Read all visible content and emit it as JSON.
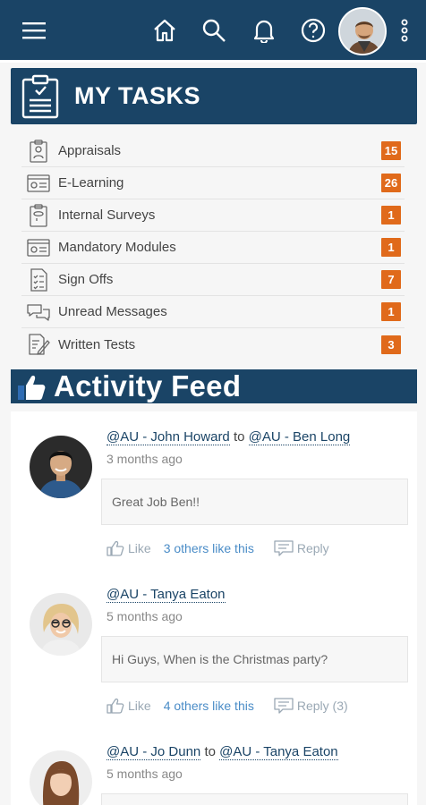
{
  "nav": {
    "menu_icon": "hamburger-menu-icon",
    "icons": [
      "home-icon",
      "search-icon",
      "bell-icon",
      "help-icon"
    ],
    "more_icon": "vertical-dots-icon"
  },
  "tasks": {
    "title": "MY TASKS",
    "items": [
      {
        "label": "Appraisals",
        "count": "15",
        "icon": "appraisal-icon"
      },
      {
        "label": "E-Learning",
        "count": "26",
        "icon": "elearning-icon"
      },
      {
        "label": "Internal Surveys",
        "count": "1",
        "icon": "survey-icon"
      },
      {
        "label": "Mandatory Modules",
        "count": "1",
        "icon": "module-icon"
      },
      {
        "label": "Sign Offs",
        "count": "7",
        "icon": "checklist-icon"
      },
      {
        "label": "Unread Messages",
        "count": "1",
        "icon": "chat-icon"
      },
      {
        "label": "Written Tests",
        "count": "3",
        "icon": "pencil-doc-icon"
      }
    ]
  },
  "feed": {
    "title": "Activity Feed",
    "posts": [
      {
        "author": "@AU - John Howard",
        "connector": "to",
        "target": "@AU - Ben Long",
        "time": "3 months ago",
        "message": "Great Job Ben!!",
        "like_label": "Like",
        "likes_text": "3 others like this",
        "reply_label": "Reply"
      },
      {
        "author": "@AU - Tanya Eaton",
        "connector": "",
        "target": "",
        "time": "5 months ago",
        "message": "Hi Guys, When is the Christmas party?",
        "like_label": "Like",
        "likes_text": "4 others like this",
        "reply_label": "Reply (3)"
      },
      {
        "author": "@AU - Jo Dunn",
        "connector": "to",
        "target": "@AU - Tanya Eaton",
        "time": "5 months ago",
        "message": "",
        "like_label": "",
        "likes_text": "",
        "reply_label": ""
      }
    ]
  },
  "colors": {
    "primary": "#1a4466",
    "badge": "#e06a1b",
    "link": "#4a8cc7"
  }
}
